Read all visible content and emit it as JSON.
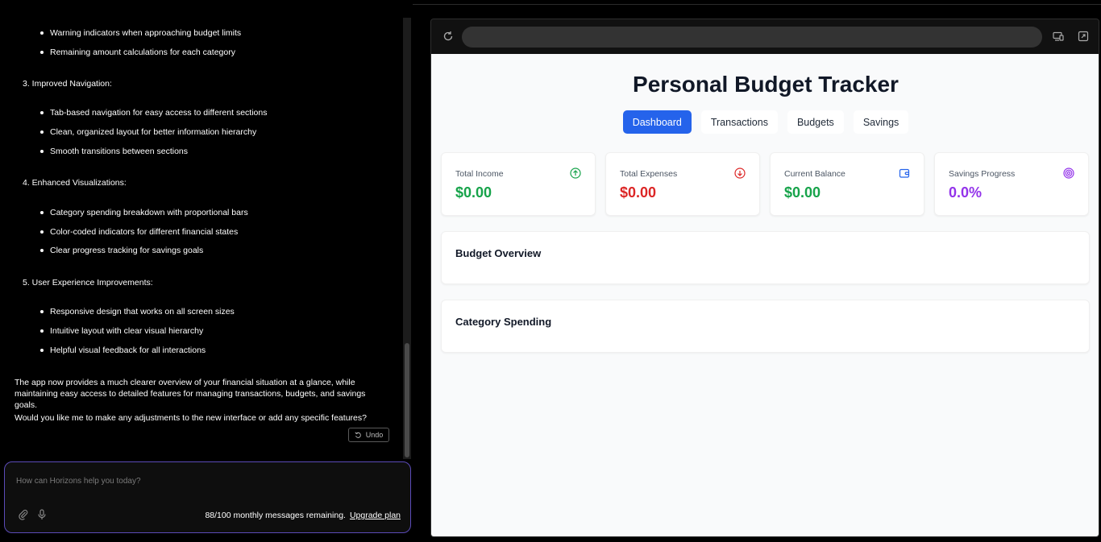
{
  "chat": {
    "bullets_top": [
      "Warning indicators when approaching budget limits",
      "Remaining amount calculations for each category"
    ],
    "section3": {
      "heading": "3. Improved Navigation:",
      "bullets": [
        "Tab-based navigation for easy access to different sections",
        "Clean, organized layout for better information hierarchy",
        "Smooth transitions between sections"
      ]
    },
    "section4": {
      "heading": "4. Enhanced Visualizations:",
      "bullets": [
        "Category spending breakdown with proportional bars",
        "Color-coded indicators for different financial states",
        "Clear progress tracking for savings goals"
      ]
    },
    "section5": {
      "heading": "5. User Experience Improvements:",
      "bullets": [
        "Responsive design that works on all screen sizes",
        "Intuitive layout with clear visual hierarchy",
        "Helpful visual feedback for all interactions"
      ]
    },
    "summary": "The app now provides a much clearer overview of your financial situation at a glance, while maintaining easy access to detailed features for managing transactions, budgets, and savings goals.",
    "question": "Would you like me to make any adjustments to the new interface or add any specific features?",
    "undo_label": "Undo"
  },
  "input": {
    "placeholder": "How can Horizons help you today?",
    "messages_remaining": "88/100 monthly messages remaining.",
    "upgrade_label": "Upgrade plan"
  },
  "app": {
    "title": "Personal Budget Tracker",
    "tabs": [
      {
        "label": "Dashboard",
        "active": true
      },
      {
        "label": "Transactions",
        "active": false
      },
      {
        "label": "Budgets",
        "active": false
      },
      {
        "label": "Savings",
        "active": false
      }
    ],
    "cards": [
      {
        "label": "Total Income",
        "value": "$0.00",
        "color": "#16a34a",
        "icon": "arrow-up-circle-icon"
      },
      {
        "label": "Total Expenses",
        "value": "$0.00",
        "color": "#dc2626",
        "icon": "arrow-down-circle-icon"
      },
      {
        "label": "Current Balance",
        "value": "$0.00",
        "color": "#16a34a",
        "icon": "wallet-icon"
      },
      {
        "label": "Savings Progress",
        "value": "0.0%",
        "color": "#9333ea",
        "icon": "target-icon"
      }
    ],
    "sections": {
      "budget_overview": "Budget Overview",
      "category_spending": "Category Spending"
    }
  },
  "colors": {
    "accent": "#2563eb",
    "input_border": "#5b4bb8"
  }
}
